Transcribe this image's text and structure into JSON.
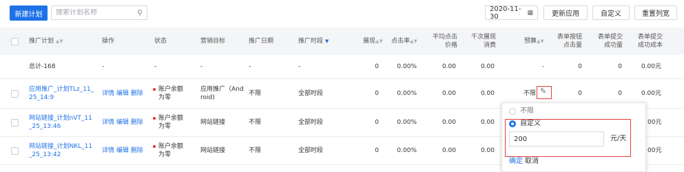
{
  "toolbar": {
    "new_plan": "新建计划",
    "search_placeholder": "搜索计划名称",
    "date": "2020-11-30",
    "update_app": "更新应用",
    "custom": "自定义",
    "reset_width": "重置列宽"
  },
  "columns": {
    "plan": "推广计划",
    "op": "操作",
    "status": "状态",
    "goal": "营销目标",
    "date": "推广日期",
    "period": "推广时段",
    "impressions": "展现",
    "ctr": "点击率",
    "avg_click_price_1": "平均点击",
    "avg_click_price_2": "价格",
    "cpm_1": "千次展现",
    "cpm_2": "消费",
    "budget": "预算",
    "form_clicks_1": "表单按钮",
    "form_clicks_2": "点击量",
    "form_submit_1": "表单提交",
    "form_submit_2": "成功量",
    "form_cost_1": "表单提交",
    "form_cost_2": "成功成本"
  },
  "total": {
    "label": "总计-168",
    "dash": "-",
    "impressions": "0",
    "ctr": "0.00%",
    "avg_price": "0.00",
    "cpm": "0.00",
    "form_clicks": "0",
    "form_submit": "0",
    "form_cost": "0.00元"
  },
  "rows": [
    {
      "name_1": "应用推广_计划TLz_11_",
      "name_2": "25_14:9",
      "detail": "详情",
      "edit": "编辑",
      "delete": "删除",
      "status_1": "账户余额",
      "status_2": "为零",
      "goal_1": "应用推广（And",
      "goal_2": "roid)",
      "date": "不限",
      "period": "全部时段",
      "impressions": "0",
      "ctr": "0.00%",
      "avg_price": "0.00",
      "cpm": "0.00",
      "budget": "不限",
      "form_clicks": "0",
      "form_submit": "0",
      "form_cost": "0.00元"
    },
    {
      "name_1": "网站链接_计划nVT_11",
      "name_2": "_25_13:46",
      "detail": "详情",
      "edit": "编辑",
      "delete": "删除",
      "status_1": "账户余额",
      "status_2": "为零",
      "goal_1": "网站链接",
      "goal_2": "",
      "date": "不限",
      "period": "全部时段",
      "impressions": "0",
      "ctr": "0.00%",
      "avg_price": "0.00",
      "cpm": "0.00",
      "budget": "",
      "form_clicks": "",
      "form_submit": "",
      "form_cost": "00元"
    },
    {
      "name_1": "网站链接_计划NKL_11",
      "name_2": "_25_13:42",
      "detail": "详情",
      "edit": "编辑",
      "delete": "删除",
      "status_1": "账户余额",
      "status_2": "为零",
      "goal_1": "网站链接",
      "goal_2": "",
      "date": "不限",
      "period": "全部时段",
      "impressions": "0",
      "ctr": "0.00%",
      "avg_price": "0.00",
      "cpm": "0.00",
      "budget": "",
      "form_clicks": "",
      "form_submit": "",
      "form_cost": "00元"
    }
  ],
  "popup": {
    "option_unlimited": "不限",
    "option_custom": "自定义",
    "value": "200",
    "unit": "元/天",
    "confirm": "确定",
    "cancel": "取消"
  },
  "colors": {
    "accent": "#1e72e8",
    "highlight": "#e23b3b",
    "status_dot": "#e6332a"
  }
}
